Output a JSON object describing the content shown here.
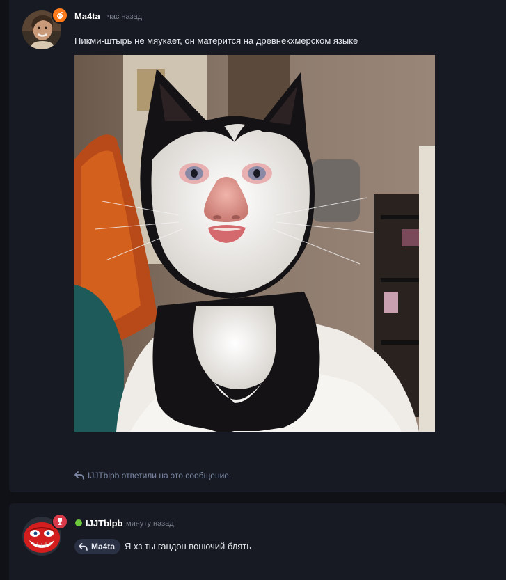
{
  "messages": [
    {
      "author": "Ma4ta",
      "time": "час назад",
      "text": "Пикми-штырь не мяукает, он матерится на древнекхмерском языке",
      "image_alt": "Фото кота",
      "replies_note": "IJJTblpb ответили на это сообщение.",
      "badge_color": "#ff7a1a"
    },
    {
      "author": "IJJTblpb",
      "time": "минуту назад",
      "reply_to": "Ma4ta",
      "text": "Я хз ты гандон вонючий блять",
      "status": "online",
      "badge_color": "#d83a4a"
    }
  ],
  "colors": {
    "background": "#0f1117",
    "card": "#171a22",
    "online": "#6cc93a",
    "muted_text": "#7d8290"
  }
}
